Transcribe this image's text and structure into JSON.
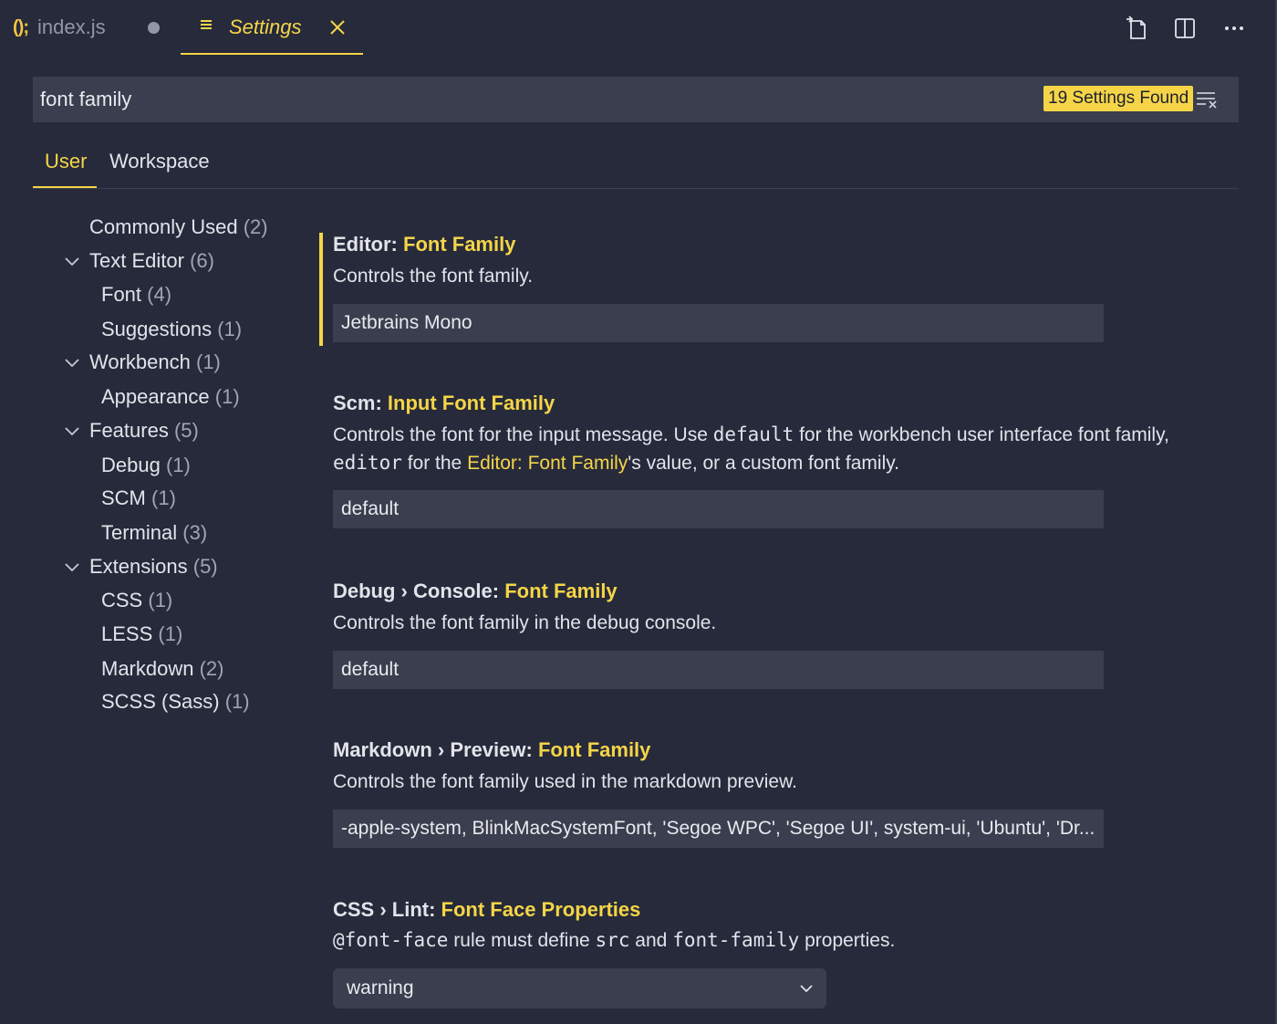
{
  "tabs": {
    "file": {
      "icon": "()",
      "semi": ";",
      "label": "index.js"
    },
    "settings": {
      "label": "Settings"
    }
  },
  "search": {
    "value": "font family",
    "count_label": "19 Settings Found"
  },
  "scopes": [
    "User",
    "Workspace"
  ],
  "toc": [
    {
      "label": "Commonly Used",
      "count": "(2)",
      "level": 0,
      "expandable": false
    },
    {
      "label": "Text Editor",
      "count": "(6)",
      "level": 0,
      "expandable": true
    },
    {
      "label": "Font",
      "count": "(4)",
      "level": 1,
      "expandable": false
    },
    {
      "label": "Suggestions",
      "count": "(1)",
      "level": 1,
      "expandable": false
    },
    {
      "label": "Workbench",
      "count": "(1)",
      "level": 0,
      "expandable": true
    },
    {
      "label": "Appearance",
      "count": "(1)",
      "level": 1,
      "expandable": false
    },
    {
      "label": "Features",
      "count": "(5)",
      "level": 0,
      "expandable": true
    },
    {
      "label": "Debug",
      "count": "(1)",
      "level": 1,
      "expandable": false
    },
    {
      "label": "SCM",
      "count": "(1)",
      "level": 1,
      "expandable": false
    },
    {
      "label": "Terminal",
      "count": "(3)",
      "level": 1,
      "expandable": false
    },
    {
      "label": "Extensions",
      "count": "(5)",
      "level": 0,
      "expandable": true
    },
    {
      "label": "CSS",
      "count": "(1)",
      "level": 1,
      "expandable": false
    },
    {
      "label": "LESS",
      "count": "(1)",
      "level": 1,
      "expandable": false
    },
    {
      "label": "Markdown",
      "count": "(2)",
      "level": 1,
      "expandable": false
    },
    {
      "label": "SCSS (Sass)",
      "count": "(1)",
      "level": 1,
      "expandable": false
    }
  ],
  "settings": [
    {
      "category": "Editor: ",
      "name": "Font Family",
      "description": "Controls the font family.",
      "value": "Jetbrains Mono"
    },
    {
      "category": "Scm: ",
      "name": "Input Font Family",
      "desc_part1": "Controls the font for the input message. Use ",
      "desc_code1": "default",
      "desc_part2": " for the workbench user interface font family, ",
      "desc_code2": "editor",
      "desc_part3": " for the ",
      "desc_link": "Editor: Font Family",
      "desc_part4": "'s value, or a custom font family.",
      "value": "default"
    },
    {
      "category": "Debug › Console: ",
      "name": "Font Family",
      "description": "Controls the font family in the debug console.",
      "value": "default"
    },
    {
      "category": "Markdown › Preview: ",
      "name": "Font Family",
      "description": "Controls the font family used in the markdown preview.",
      "value": "-apple-system, BlinkMacSystemFont, 'Segoe WPC', 'Segoe UI', system-ui, 'Ubuntu', 'Dr..."
    },
    {
      "category": "CSS › Lint: ",
      "name": "Font Face Properties",
      "desc_code1": "@font-face",
      "desc_part1": " rule must define ",
      "desc_code2": "src",
      "desc_part2": " and ",
      "desc_code3": "font-family",
      "desc_part3": " properties.",
      "value": "warning"
    }
  ],
  "icons": {
    "tab_actions": [
      "open-settings-json-icon",
      "split-editor-icon",
      "more-actions-icon"
    ],
    "clear": "clear-filter-icon",
    "toc_chevron": "chevron-down-icon"
  },
  "colors": {
    "background": "#262a3b",
    "accent": "#f5d547",
    "input_bg": "#3a3e4e"
  }
}
